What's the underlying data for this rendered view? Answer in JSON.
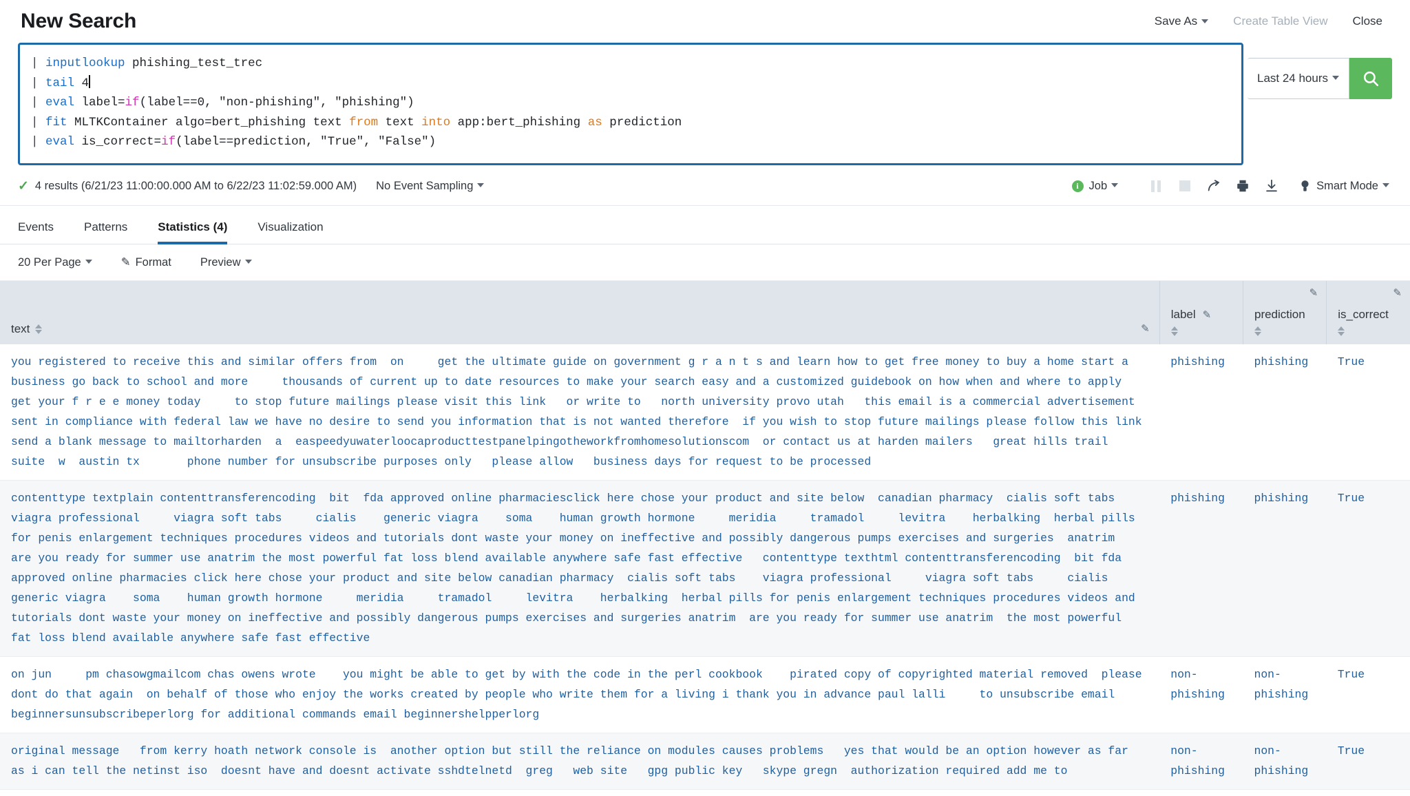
{
  "header": {
    "title": "New Search",
    "actions": [
      {
        "label": "Save As",
        "caret": true,
        "disabled": false
      },
      {
        "label": "Create Table View",
        "caret": false,
        "disabled": true
      },
      {
        "label": "Close",
        "caret": false,
        "disabled": false
      }
    ]
  },
  "search": {
    "lines": [
      {
        "pipe": "| ",
        "cmd": "inputlookup",
        "rest": " phishing_test_trec"
      },
      {
        "pipe": "| ",
        "cmd": "tail",
        "rest": " 4"
      },
      {
        "pipe": "| ",
        "cmd": "eval",
        "rest": " label=if(label==0, \"non-phishing\", \"phishing\")"
      },
      {
        "pipe": "| ",
        "cmd": "fit",
        "rest": " MLTKContainer algo=bert_phishing text from text into app:bert_phishing as prediction"
      },
      {
        "pipe": "| ",
        "cmd": "eval",
        "rest": " is_correct=if(label==prediction, \"True\", \"False\")"
      }
    ],
    "time_range": "Last 24 hours",
    "search_icon": "magnifier-icon",
    "accent_color": "#1e69a8",
    "run_button_color": "#5cb85c"
  },
  "status": {
    "results": "4 results (6/21/23 11:00:00.000 AM to 6/22/23 11:02:59.000 AM)",
    "sampling": "No Event Sampling",
    "job": "Job",
    "mode": "Smart Mode",
    "controls": [
      "pause-icon",
      "stop-icon",
      "share-icon",
      "print-icon",
      "export-icon"
    ]
  },
  "tabs": [
    {
      "label": "Events",
      "active": false
    },
    {
      "label": "Patterns",
      "active": false
    },
    {
      "label": "Statistics (4)",
      "active": true
    },
    {
      "label": "Visualization",
      "active": false
    }
  ],
  "toolbar": {
    "per_page": "20 Per Page",
    "format": "Format",
    "preview": "Preview"
  },
  "table": {
    "columns": [
      "text",
      "label",
      "prediction",
      "is_correct"
    ],
    "rows": [
      {
        "text": "you registered to receive this and similar offers from  on     get the ultimate guide on government g r a n t s and learn how to get free money to buy a home start a business go back to school and more     thousands of current up to date resources to make your search easy and a customized guidebook on how when and where to apply  get your f r e e money today     to stop future mailings please visit this link   or write to   north university provo utah   this email is a commercial advertisement sent in compliance with federal law we have no desire to send you information that is not wanted therefore  if you wish to stop future mailings please follow this link   send a blank message to mailtorharden  a  easpeedyuwaterloocaproducttestpanelpingotheworkfromhomesolutionscom  or contact us at harden mailers   great hills trail suite  w  austin tx       phone number for unsubscribe purposes only   please allow   business days for request to be processed",
        "label": "phishing",
        "prediction": "phishing",
        "is_correct": "True"
      },
      {
        "text": "contenttype textplain contenttransferencoding  bit  fda approved online pharmaciesclick here chose your product and site below  canadian pharmacy  cialis soft tabs    viagra professional     viagra soft tabs     cialis    generic viagra    soma    human growth hormone     meridia     tramadol     levitra    herbalking  herbal pills for penis enlargement techniques procedures videos and tutorials dont waste your money on ineffective and possibly dangerous pumps exercises and surgeries  anatrim  are you ready for summer use anatrim the most powerful fat loss blend available anywhere safe fast effective   contenttype texthtml contenttransferencoding  bit fda approved online pharmacies click here chose your product and site below canadian pharmacy  cialis soft tabs    viagra professional     viagra soft tabs     cialis    generic viagra    soma    human growth hormone     meridia     tramadol     levitra    herbalking  herbal pills for penis enlargement techniques procedures videos and tutorials dont waste your money on ineffective and possibly dangerous pumps exercises and surgeries anatrim  are you ready for summer use anatrim  the most powerful fat loss blend available anywhere safe fast effective",
        "label": "phishing",
        "prediction": "phishing",
        "is_correct": "True"
      },
      {
        "text": "on jun     pm chasowgmailcom chas owens wrote    you might be able to get by with the code in the perl cookbook    pirated copy of copyrighted material removed  please dont do that again  on behalf of those who enjoy the works created by people who write them for a living i thank you in advance paul lalli     to unsubscribe email beginnersunsubscribeperlorg for additional commands email beginnershelpperlorg",
        "label": "non-phishing",
        "prediction": "non-phishing",
        "is_correct": "True"
      },
      {
        "text": "original message   from kerry hoath network console is  another option but still the reliance on modules causes problems   yes that would be an option however as far as i can tell the netinst iso  doesnt have and doesnt activate sshdtelnetd  greg   web site   gpg public key   skype gregn  authorization required add me to",
        "label": "non-phishing",
        "prediction": "non-phishing",
        "is_correct": "True"
      }
    ]
  }
}
